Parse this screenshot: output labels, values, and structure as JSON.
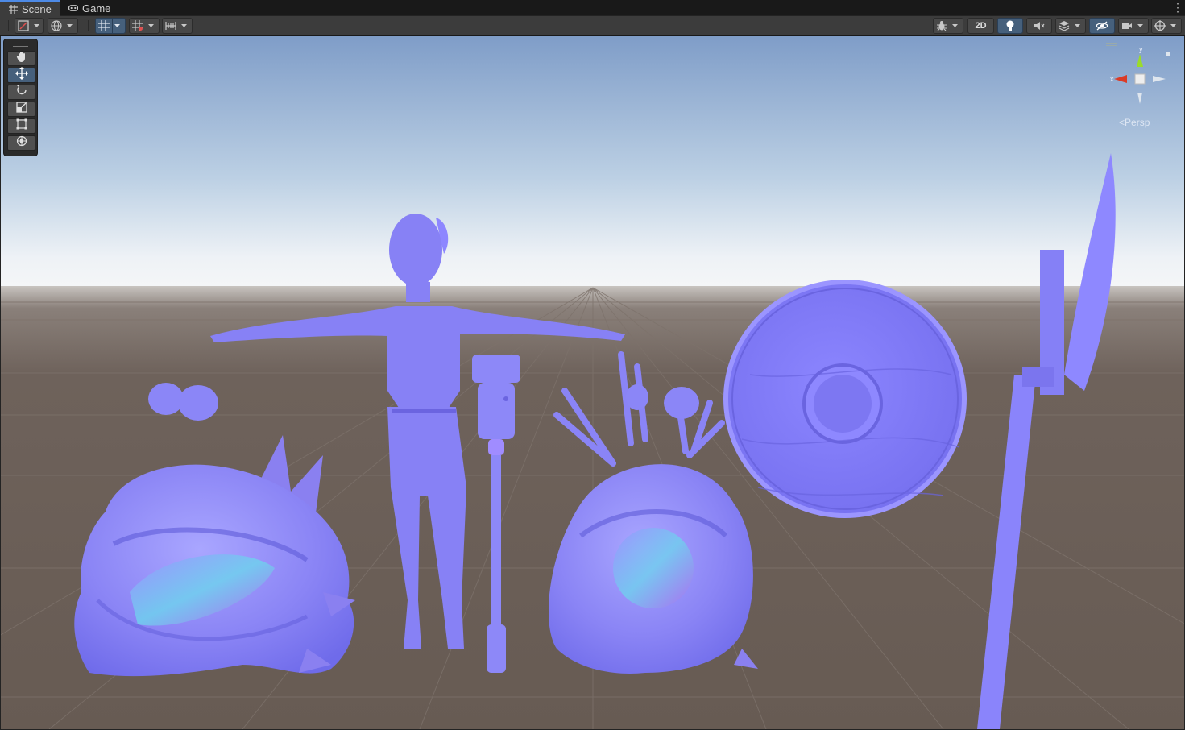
{
  "tabs": [
    {
      "label": "Scene",
      "icon": "grid-icon",
      "active": true
    },
    {
      "label": "Game",
      "icon": "gamepad-icon",
      "active": false
    }
  ],
  "toolbar": {
    "left": [
      {
        "name": "draw-mode-dropdown",
        "icon": "shaded-icon",
        "dropdown": true
      },
      {
        "name": "global-local-dropdown",
        "icon": "globe-icon",
        "dropdown": true
      },
      {
        "name": "grid-snapping-dropdown",
        "icon": "grid-snap-icon",
        "dropdown": true,
        "active": true
      },
      {
        "name": "increment-snap-dropdown",
        "icon": "increment-snap-icon",
        "dropdown": true
      },
      {
        "name": "align-dropdown",
        "icon": "ruler-icon",
        "dropdown": true
      }
    ],
    "right": [
      {
        "name": "effects-dropdown",
        "icon": "bug-icon",
        "dropdown": true
      },
      {
        "name": "2d-toggle",
        "label": "2D"
      },
      {
        "name": "lighting-toggle",
        "icon": "bulb-icon",
        "active": true
      },
      {
        "name": "audio-toggle",
        "icon": "speaker-muted-icon"
      },
      {
        "name": "scene-fx-dropdown",
        "icon": "layers-icon",
        "dropdown": true
      },
      {
        "name": "visibility-toggle",
        "icon": "eye-hidden-icon",
        "active": true
      },
      {
        "name": "camera-dropdown",
        "icon": "camera-icon",
        "dropdown": true
      },
      {
        "name": "gizmos-dropdown",
        "icon": "gizmo-icon",
        "dropdown": true
      }
    ]
  },
  "tools": [
    {
      "name": "hand-tool",
      "icon": "hand-icon",
      "active": false
    },
    {
      "name": "move-tool",
      "icon": "move-arrows-icon",
      "active": true
    },
    {
      "name": "rotate-tool",
      "icon": "rotate-icon",
      "active": false
    },
    {
      "name": "scale-tool",
      "icon": "scale-icon",
      "active": false
    },
    {
      "name": "rect-tool",
      "icon": "rect-icon",
      "active": false
    },
    {
      "name": "transform-tool",
      "icon": "transform-icon",
      "active": false
    }
  ],
  "gizmo": {
    "projection_label": "Persp",
    "axis_y": "y",
    "axis_x": "x",
    "colors": {
      "x": "#db3b26",
      "y": "#9bdc29",
      "z": "#3d7fe6",
      "center": "#eeeeee"
    }
  },
  "scene": {
    "sky_top": "#7f9dc8",
    "sky_horizon": "#f2f4f6",
    "ground": "#6b5f57",
    "normal_map_color": "#8080ff",
    "objects": [
      "creature-left",
      "female-character",
      "mace",
      "creature-right",
      "round-shield",
      "halberd"
    ]
  }
}
